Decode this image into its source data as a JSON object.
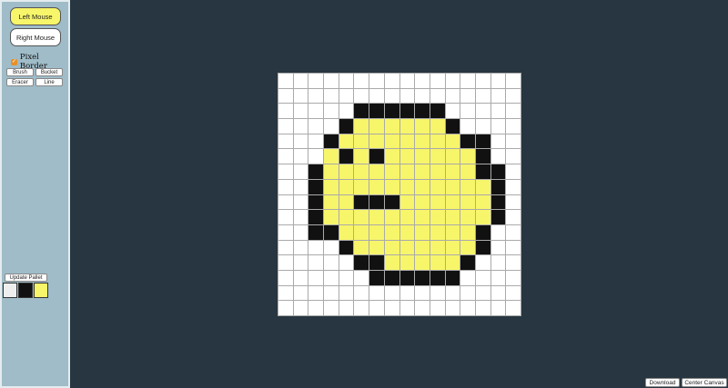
{
  "sidebar": {
    "left_mouse_label": "Left Mouse",
    "right_mouse_label": "Right Mouse",
    "pixel_border_label": "Pixel Border",
    "pixel_border_checked": true,
    "tools": [
      "Brush",
      "Bucket",
      "Eracer",
      "Line"
    ],
    "update_pallet_label": "Update Pallet",
    "palette": [
      "#eeeeee",
      "#111111",
      "#f7f56a"
    ],
    "left_mouse_color": "#f7f56a",
    "right_mouse_color": "#ffffff"
  },
  "canvas": {
    "grid_size": 16,
    "colors": {
      "0": "#ffffff",
      "1": "#111111",
      "2": "#f7f56a"
    },
    "pixels": [
      "0000000000000000",
      "0000000000000000",
      "0000011111100000",
      "0000122222210000",
      "0001222222221100",
      "0002121222222100",
      "0012222222222110",
      "0012222222222210",
      "0012211122222210",
      "0012222222222210",
      "0011222222222100",
      "0000122222222100",
      "0000011222221000",
      "0000001111110000",
      "0000000000000000",
      "0000000000000000"
    ]
  },
  "footer": {
    "download_label": "Download",
    "center_canvas_label": "Center Canvas"
  }
}
